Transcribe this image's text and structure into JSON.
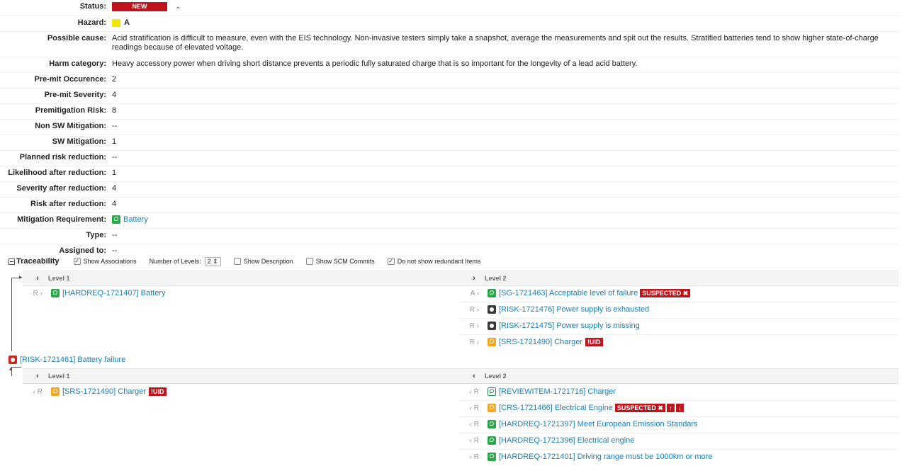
{
  "properties": {
    "status": {
      "label": "Status:",
      "value": "NEW"
    },
    "hazard": {
      "label": "Hazard:",
      "value": "A",
      "color": "#f4e400"
    },
    "possible_cause": {
      "label": "Possible cause:",
      "value": "Acid stratification is difficult to measure, even with the EIS technology. Non-invasive testers simply take a snapshot, average the measurements and spit out the results. Stratified batteries tend to show higher state-of-charge readings because of elevated voltage."
    },
    "harm_category": {
      "label": "Harm category:",
      "value": "Heavy accessory power when driving short distance prevents a periodic fully saturated charge that is so important for the longevity of a lead acid battery."
    },
    "pre_mit_occurence": {
      "label": "Pre-mit Occurence:",
      "value": "2"
    },
    "pre_mit_severity": {
      "label": "Pre-mit Severity:",
      "value": "4"
    },
    "premitigation_risk": {
      "label": "Premitigation Risk:",
      "value": "8"
    },
    "non_sw_mitigation": {
      "label": "Non SW Mitigation:",
      "value": "--"
    },
    "sw_mitigation": {
      "label": "SW Mitigation:",
      "value": "1"
    },
    "planned_risk_reduction": {
      "label": "Planned risk reduction:",
      "value": "--"
    },
    "likelihood_after": {
      "label": "Likelihood after reduction:",
      "value": "1"
    },
    "severity_after": {
      "label": "Severity after reduction:",
      "value": "4"
    },
    "risk_after": {
      "label": "Risk after reduction:",
      "value": "4"
    },
    "mitigation_requirement": {
      "label": "Mitigation Requirement:",
      "value": "Battery",
      "icon": "requirement-icon"
    },
    "type": {
      "label": "Type:",
      "value": "--"
    },
    "assigned_to": {
      "label": "Assigned to:",
      "value": "--"
    }
  },
  "traceability": {
    "title": "Traceability",
    "show_associations": {
      "label": "Show Associations",
      "checked": true
    },
    "number_of_levels": {
      "label": "Number of Levels:",
      "value": "2"
    },
    "show_description": {
      "label": "Show Description",
      "checked": false
    },
    "show_scm_commits": {
      "label": "Show SCM Commits",
      "checked": false
    },
    "no_redundant": {
      "label": "Do not show redundant Items",
      "checked": true
    },
    "level1_label": "Level 1",
    "level2_label": "Level 2",
    "downstream": {
      "level1": [
        {
          "rel": "R",
          "text": "[HARDREQ-1721407] Battery",
          "icon": "green"
        }
      ],
      "level2": [
        {
          "rel": "A",
          "text": "[SG-1721463] Acceptable level of failure",
          "icon": "green",
          "badge": "SUSPECTED ✖"
        },
        {
          "rel": "R",
          "text": "[RISK-1721476] Power supply is exhausted",
          "icon": "dark"
        },
        {
          "rel": "R",
          "text": "[RISK-1721475] Power supply is missing",
          "icon": "dark"
        },
        {
          "rel": "R",
          "text": "[SRS-1721490] Charger",
          "icon": "orange",
          "uid": "!UID"
        }
      ]
    },
    "root": {
      "text": "[RISK-1721461] Battery failure",
      "icon": "red"
    },
    "upstream": {
      "level1": [
        {
          "rel": "R",
          "text": "[SRS-1721490] Charger",
          "icon": "orange",
          "uid": "!UID"
        }
      ],
      "level2": [
        {
          "rel": "R",
          "text": "[REVIEWITEM-1721716] Charger",
          "icon": "review"
        },
        {
          "rel": "R",
          "text": "[CRS-1721466] Electrical Engine",
          "icon": "orange",
          "badge": "SUSPECTED ✖",
          "arrows": [
            "↑",
            "↓"
          ]
        },
        {
          "rel": "R",
          "text": "[HARDREQ-1721397] Meet European Emission Standars",
          "icon": "green"
        },
        {
          "rel": "R",
          "text": "[HARDREQ-1721396] Electrical engine",
          "icon": "green"
        },
        {
          "rel": "R",
          "text": "[HARDREQ-1721401] Driving range must be 1000km or more",
          "icon": "green"
        }
      ]
    }
  }
}
